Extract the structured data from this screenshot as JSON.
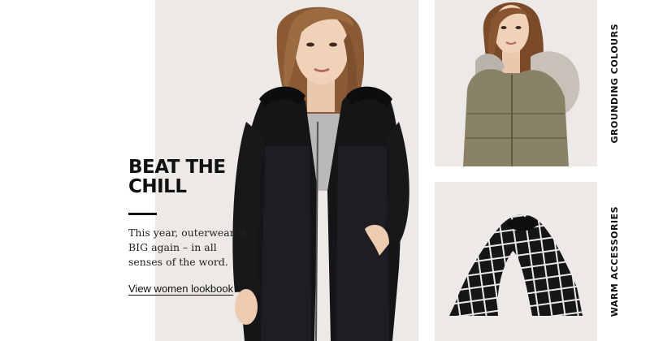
{
  "promo": {
    "headline_line1": "BEAT THE",
    "headline_line2": "CHILL",
    "body": "This year, outerwear is BIG again – in all senses of the word.",
    "link_label": "View women lookbook"
  },
  "tiles": [
    {
      "label": "GROUNDING COLOURS"
    },
    {
      "label": "WARM ACCESSORIES"
    }
  ],
  "colors": {
    "panel_background": "#ece9e6",
    "text": "#111111",
    "coat": "#151518",
    "jacket": "#8a8266"
  },
  "icons": [
    "model-photo",
    "jacket-photo",
    "scarf-photo"
  ]
}
